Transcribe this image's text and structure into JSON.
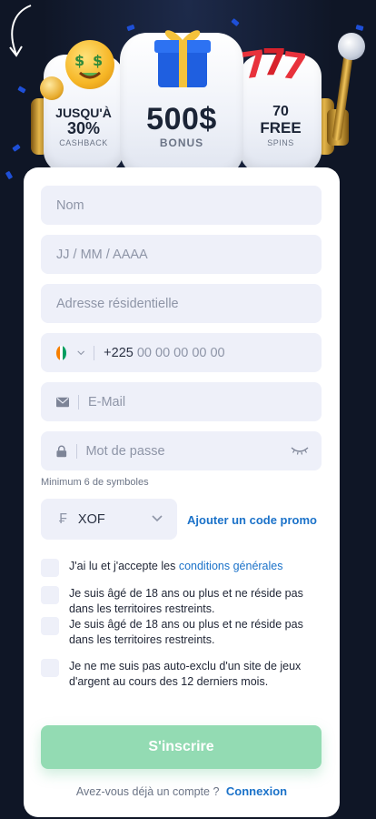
{
  "hero": {
    "left_top": "JUSQU'À",
    "left_big": "30%",
    "left_sub": "CASHBACK",
    "center_big": "500$",
    "center_sub": "BONUS",
    "right_top": "70",
    "right_big": "FREE",
    "right_sub": "SPINS",
    "icons": [
      "money-face-icon",
      "coin-icon",
      "gift-icon",
      "sevens-icon",
      "lever-icon",
      "curved-arrow-icon"
    ]
  },
  "form": {
    "name_placeholder": "Nom",
    "birthdate_placeholder": "JJ / MM / AAAA",
    "address_placeholder": "Adresse résidentielle",
    "phone_prefix": "+225",
    "phone_placeholder": "00 00 00 00 00",
    "email_placeholder": "E-Mail",
    "password_placeholder": "Mot de passe",
    "password_hint": "Minimum 6 de symboles",
    "currency_symbol": "₣",
    "currency_value": "XOF",
    "promo_link": "Ajouter un code promo",
    "terms_prefix": "J'ai lu et j'accepte les",
    "terms_link": "conditions générales",
    "age_check_1": "Je suis âgé de 18 ans ou plus et ne réside pas dans les territoires restreints.",
    "age_check_2": "Je suis âgé de 18 ans ou plus et ne réside pas dans les territoires restreints.",
    "self_exclusion_check": "Je ne me suis pas auto-exclu d'un site de jeux d'argent au cours des 12 derniers mois.",
    "submit_label": "S'inscrire",
    "have_account_text": "Avez-vous déjà un compte ?",
    "login_link": "Connexion"
  },
  "colors": {
    "background": "#0f1626",
    "accent_link": "#1b72c9",
    "submit_button": "#93dbb3",
    "field_bg": "#eef0f9"
  }
}
